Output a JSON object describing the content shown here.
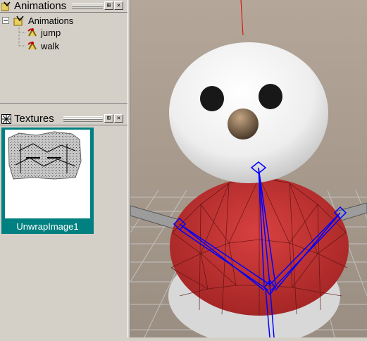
{
  "animations_panel": {
    "title": "Animations",
    "root_label": "Animations",
    "items": [
      {
        "label": "jump"
      },
      {
        "label": "walk"
      }
    ],
    "pin_button": "⊞",
    "close_button": "✕"
  },
  "textures_panel": {
    "title": "Textures",
    "items": [
      {
        "label": "UnwrapImage1"
      }
    ],
    "pin_button": "⊞",
    "close_button": "✕"
  },
  "colors": {
    "selection": "#008080",
    "bone": "#0000ff",
    "body": "#c8322e",
    "snow": "#f2f2f2"
  }
}
